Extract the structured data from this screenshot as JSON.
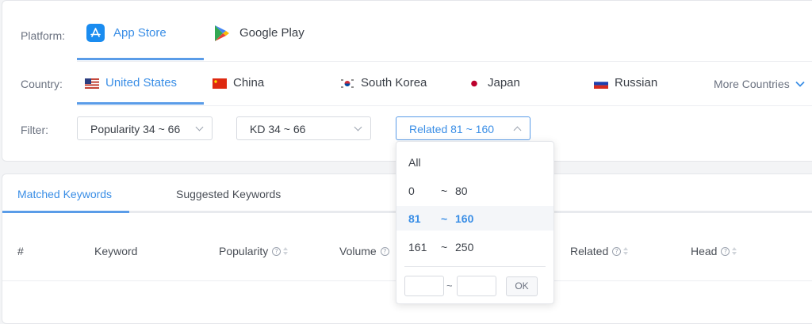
{
  "filters_panel": {
    "platform_label": "Platform:",
    "platforms": [
      {
        "label": "App Store",
        "icon": "app-store-icon",
        "active": true
      },
      {
        "label": "Google Play",
        "icon": "google-play-icon",
        "active": false
      }
    ],
    "country_label": "Country:",
    "countries": [
      {
        "label": "United States",
        "flag": "us-flag-icon",
        "active": true
      },
      {
        "label": "China",
        "flag": "china-flag-icon",
        "active": false
      },
      {
        "label": "South Korea",
        "flag": "south-korea-flag-icon",
        "active": false
      },
      {
        "label": "Japan",
        "flag": "japan-flag-icon",
        "active": false
      },
      {
        "label": "Russian",
        "flag": "russia-flag-icon",
        "active": false
      }
    ],
    "more_countries": "More Countries",
    "filter_label": "Filter:",
    "selects": [
      {
        "value": "Popularity 34 ~ 66"
      },
      {
        "value": "KD 34 ~ 66"
      },
      {
        "value": "Related 81 ~ 160",
        "open": true
      }
    ]
  },
  "related_dropdown": {
    "options": [
      {
        "from": "All",
        "sep": "",
        "to": ""
      },
      {
        "from": "0",
        "sep": "~",
        "to": "80"
      },
      {
        "from": "81",
        "sep": "~",
        "to": "160",
        "selected": true
      },
      {
        "from": "161",
        "sep": "~",
        "to": "250"
      }
    ],
    "range_separator": "~",
    "ok_label": "OK"
  },
  "keywords_panel": {
    "tabs": [
      {
        "label": "Matched Keywords",
        "active": true
      },
      {
        "label": "Suggested Keywords",
        "active": false
      }
    ],
    "columns": [
      "#",
      "Keyword",
      "Popularity",
      "Volume",
      "Related",
      "Head"
    ]
  },
  "colors": {
    "accent": "#3a8ee6",
    "border": "#e4e6ea",
    "text": "#3a3f47"
  }
}
